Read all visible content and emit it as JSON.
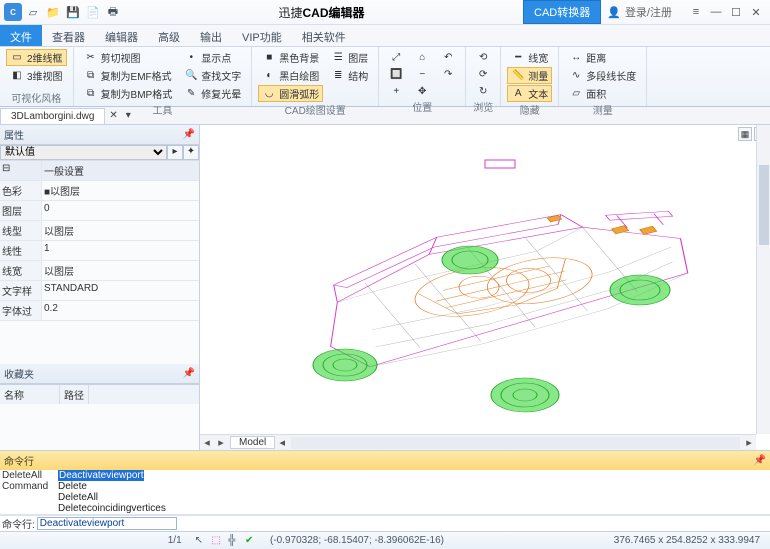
{
  "title": {
    "prefix": "迅捷",
    "app": "CAD编辑器"
  },
  "title_buttons": {
    "converter": "CAD转换器",
    "login": "登录/注册"
  },
  "menu_tabs": [
    "文件",
    "查看器",
    "编辑器",
    "高级",
    "输出",
    "VIP功能",
    "相关软件"
  ],
  "menu_active": 0,
  "ribbon": [
    {
      "label": "可视化风格",
      "cols": [
        [
          {
            "t": "2维线框",
            "sel": true,
            "ic": "wf2d"
          },
          {
            "t": "3维视图",
            "sel": false,
            "ic": "wf3d"
          }
        ]
      ]
    },
    {
      "label": "工具",
      "cols": [
        [
          {
            "t": "剪切视图",
            "ic": "scis"
          },
          {
            "t": "复制为EMF格式",
            "ic": "copy"
          },
          {
            "t": "复制为BMP格式",
            "ic": "copy"
          }
        ],
        [
          {
            "t": "显示点",
            "ic": "dot"
          },
          {
            "t": "查找文字",
            "ic": "find"
          },
          {
            "t": "修复光晕",
            "ic": "fix"
          }
        ]
      ]
    },
    {
      "label": "CAD绘图设置",
      "cols": [
        [
          {
            "t": "黑色背景",
            "ic": "blk"
          },
          {
            "t": "黑白绘图",
            "ic": "bw"
          },
          {
            "t": "圆滑弧形",
            "sel": true,
            "ic": "arc"
          }
        ],
        [
          {
            "t": "图层",
            "ic": "lyr"
          },
          {
            "t": "结构",
            "ic": "str"
          }
        ]
      ]
    },
    {
      "label": "位置",
      "cols": [
        [
          {
            "t": "",
            "ic": "fit"
          },
          {
            "t": "",
            "ic": "zwin"
          },
          {
            "t": "",
            "ic": "zin"
          }
        ],
        [
          {
            "t": "",
            "ic": "home"
          },
          {
            "t": "",
            "ic": "zout"
          },
          {
            "t": "",
            "ic": "pan"
          }
        ],
        [
          {
            "t": "",
            "ic": "und"
          },
          {
            "t": "",
            "ic": "red"
          }
        ]
      ]
    },
    {
      "label": "浏览",
      "cols": [
        [
          {
            "t": "",
            "ic": "bf"
          },
          {
            "t": "",
            "ic": "bb"
          },
          {
            "t": "",
            "ic": "bl"
          }
        ]
      ]
    },
    {
      "label": "隐藏",
      "cols": [
        [
          {
            "t": "线宽",
            "ic": "lw"
          },
          {
            "t": "测量",
            "sel": true,
            "ic": "ms"
          },
          {
            "t": "文本",
            "sel": true,
            "ic": "txt"
          }
        ]
      ]
    },
    {
      "label": "测量",
      "cols": [
        [
          {
            "t": "距离",
            "ic": "dst"
          },
          {
            "t": "多段线长度",
            "ic": "pll"
          },
          {
            "t": "面积",
            "ic": "are"
          }
        ]
      ]
    }
  ],
  "doc_tab": "3DLamborgini.dwg",
  "prop": {
    "title": "属性",
    "selector": "默认值",
    "section": "一般设置",
    "rows": [
      {
        "k": "色彩",
        "v": "■以图层"
      },
      {
        "k": "图层",
        "v": "0"
      },
      {
        "k": "线型",
        "v": "以图层"
      },
      {
        "k": "线性",
        "v": "1"
      },
      {
        "k": "线宽",
        "v": "以图层"
      },
      {
        "k": "文字样",
        "v": "STANDARD"
      },
      {
        "k": "字体过",
        "v": "0.2"
      }
    ]
  },
  "fav": {
    "title": "收藏夹",
    "cols": [
      "名称",
      "路径"
    ]
  },
  "viewport_tab": "Model",
  "cmd": {
    "title": "命令行",
    "lines": [
      {
        "l": "DeleteAll",
        "v": "Deactivateviewport",
        "sel": true
      },
      {
        "l": "Command",
        "v": "Delete"
      },
      {
        "l": "",
        "v": "DeleteAll"
      },
      {
        "l": "",
        "v": "Deletecoincidingvertices"
      }
    ],
    "input_label": "命令行:",
    "input_value": "Deactivateviewport"
  },
  "status": {
    "page": "1/1",
    "coords": "(-0.970328; -68.15407; -8.396062E-16)",
    "dims": "376.7465 x 254.8252 x 333.9947"
  }
}
